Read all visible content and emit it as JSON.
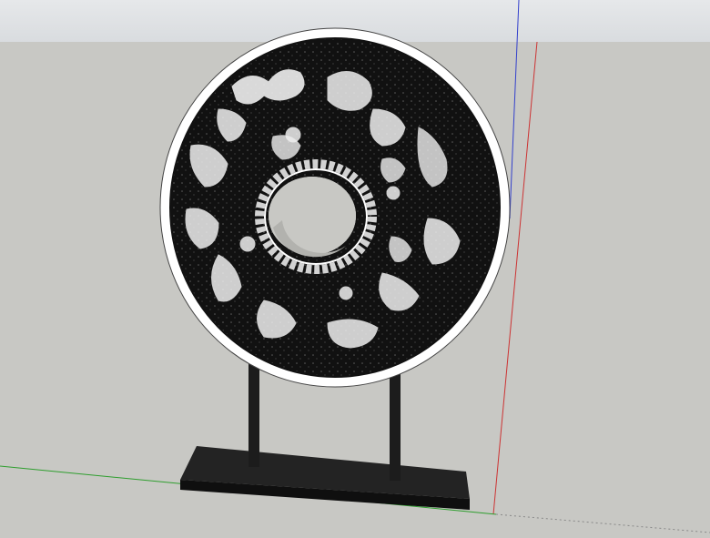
{
  "scene": {
    "description_free": true,
    "colors": {
      "sky_top": "#e6e8ea",
      "ground": "#c8c8c4",
      "disc_rim": "#ffffff",
      "disc_field": "#111111",
      "pattern": "#f2f2f2",
      "stand": "#1b1b1b",
      "axis_red": "#cc3333",
      "axis_green": "#2e9e2e",
      "axis_blue": "#3340cc"
    },
    "objects": [
      {
        "name": "jade-bi-disc-sculpture",
        "kind": "carved disc with central hole"
      },
      {
        "name": "display-stand",
        "kind": "two posts on rectangular base"
      }
    ]
  }
}
